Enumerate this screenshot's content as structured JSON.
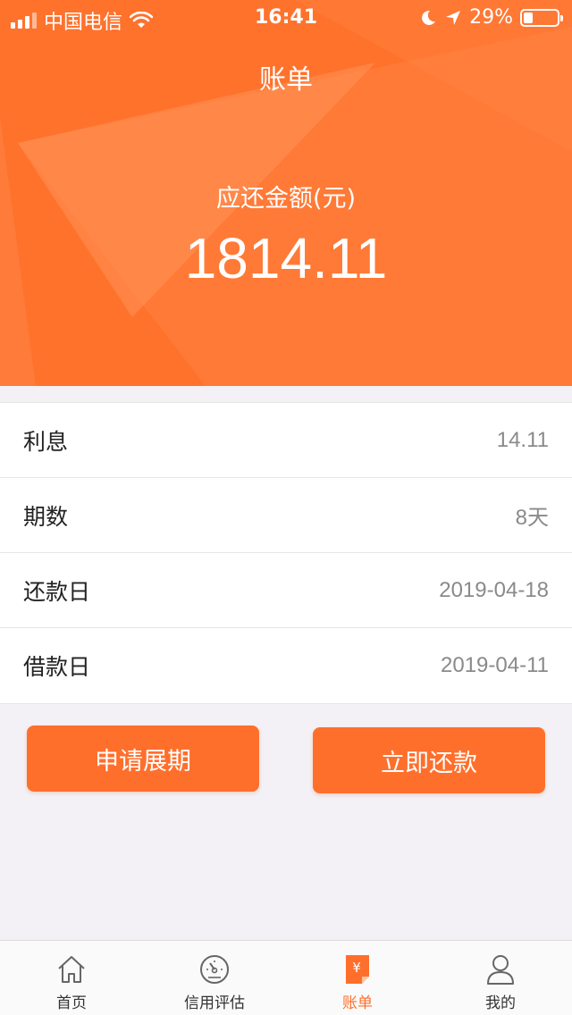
{
  "status_bar": {
    "carrier": "中国电信",
    "time": "16:41",
    "battery": "29%"
  },
  "header": {
    "title": "账单",
    "amount_label": "应还金额(元)",
    "amount_value": "1814.11"
  },
  "details": [
    {
      "label": "利息",
      "value": "14.11"
    },
    {
      "label": "期数",
      "value": "8天"
    },
    {
      "label": "还款日",
      "value": "2019-04-18"
    },
    {
      "label": "借款日",
      "value": "2019-04-11"
    }
  ],
  "buttons": {
    "extend": "申请展期",
    "repay": "立即还款"
  },
  "tabs": [
    {
      "label": "首页",
      "icon": "home-icon"
    },
    {
      "label": "信用评估",
      "icon": "gauge-icon"
    },
    {
      "label": "账单",
      "icon": "bill-icon",
      "active": true
    },
    {
      "label": "我的",
      "icon": "user-icon"
    }
  ],
  "colors": {
    "accent": "#ff722c",
    "background": "#f3f1f5"
  }
}
